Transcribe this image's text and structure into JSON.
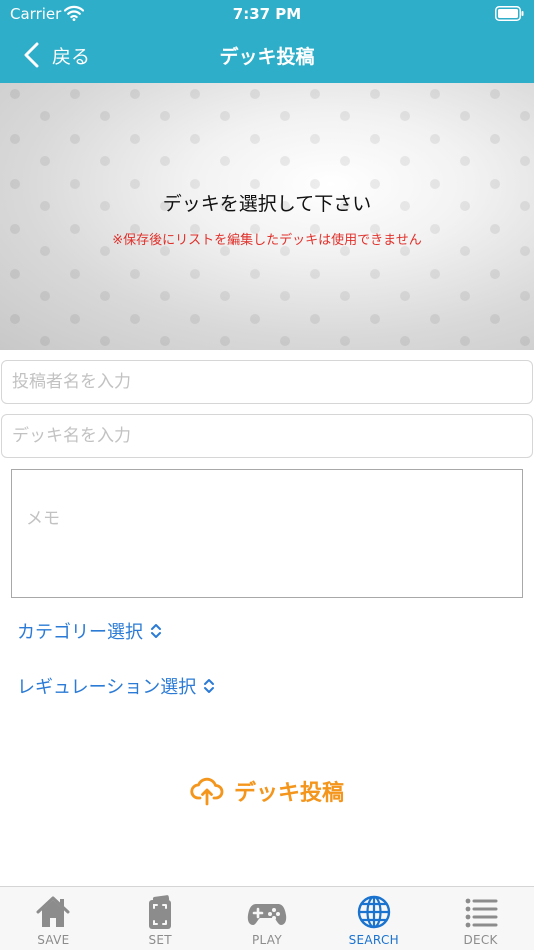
{
  "status_bar": {
    "carrier": "Carrier",
    "time": "7:37 PM"
  },
  "nav": {
    "back_label": "戻る",
    "title": "デッキ投稿"
  },
  "deck_select": {
    "prompt": "デッキを選択して下さい",
    "warning": "※保存後にリストを編集したデッキは使用できません"
  },
  "form": {
    "author_placeholder": "投稿者名を入力",
    "deck_name_placeholder": "デッキ名を入力",
    "memo_placeholder": "メモ",
    "category_label": "カテゴリー選択",
    "regulation_label": "レギュレーション選択"
  },
  "submit": {
    "label": "デッキ投稿"
  },
  "tabs": [
    {
      "label": "SAVE",
      "icon": "house-icon"
    },
    {
      "label": "SET",
      "icon": "card-frame-icon"
    },
    {
      "label": "PLAY",
      "icon": "gamepad-icon"
    },
    {
      "label": "SEARCH",
      "icon": "globe-icon",
      "active": true
    },
    {
      "label": "DECK",
      "icon": "list-icon"
    }
  ],
  "colors": {
    "header": "#2eaec9",
    "accent_blue": "#2b7bd6",
    "active_tab": "#1a73cf",
    "submit_orange": "#f4951c",
    "warning_red": "#e0302a"
  }
}
